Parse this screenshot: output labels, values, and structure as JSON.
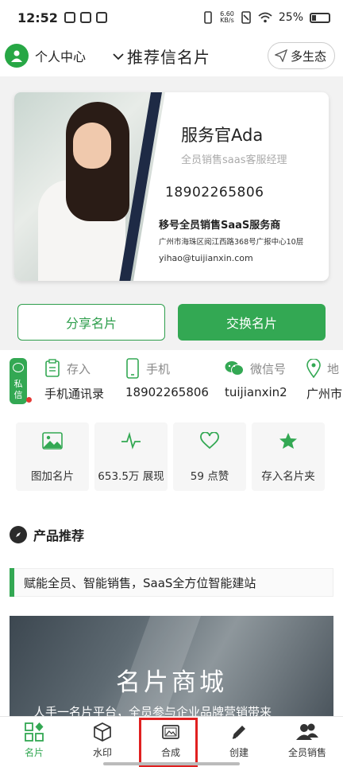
{
  "status_bar": {
    "time": "12:52",
    "speed_value": "6.60",
    "speed_unit": "KB/s",
    "battery": "25%"
  },
  "top_bar": {
    "personal_center": "个人中心",
    "title": "推荐信名片",
    "eco_button": "多生态"
  },
  "card": {
    "name": "服务官Ada",
    "role": "全员销售saas客服经理",
    "phone": "18902265806",
    "company": "移号全员销售SaaS服务商",
    "address": "广州市海珠区阅江西路368号广报中心10层",
    "email": "yihao@tuijianxin.com"
  },
  "actions": {
    "share": "分享名片",
    "exchange": "交换名片"
  },
  "private_message": {
    "line1": "私",
    "line2": "信"
  },
  "contacts": [
    {
      "label": "存入",
      "value": "手机通讯录",
      "icon": "clipboard-icon"
    },
    {
      "label": "手机",
      "value": "18902265806",
      "icon": "phone-icon"
    },
    {
      "label": "微信号",
      "value": "tuijianxin2",
      "icon": "wechat-icon"
    },
    {
      "label": "地",
      "value": "广州市",
      "icon": "location-icon"
    }
  ],
  "stats": [
    {
      "text": "图加名片",
      "icon": "image-icon"
    },
    {
      "text": "653.5万 展现",
      "icon": "pulse-icon"
    },
    {
      "text": "59 点赞",
      "icon": "heart-icon"
    },
    {
      "text": "存入名片夹",
      "icon": "star-icon"
    }
  ],
  "products": {
    "title": "产品推荐",
    "slogan": "赋能全员、智能销售，SaaS全方位智能建站",
    "banner_title": "名片商城",
    "banner_subtitle": "人手一名片平台，全员参与企业品牌营销带来"
  },
  "tabs": [
    {
      "label": "名片",
      "icon": "grid-icon",
      "active": true
    },
    {
      "label": "水印",
      "icon": "cube-icon"
    },
    {
      "label": "合成",
      "icon": "picture-icon"
    },
    {
      "label": "创建",
      "icon": "pencil-icon"
    },
    {
      "label": "全员销售",
      "icon": "users-icon"
    }
  ],
  "colors": {
    "brand_green": "#33a853",
    "highlight_red": "#e02020"
  }
}
